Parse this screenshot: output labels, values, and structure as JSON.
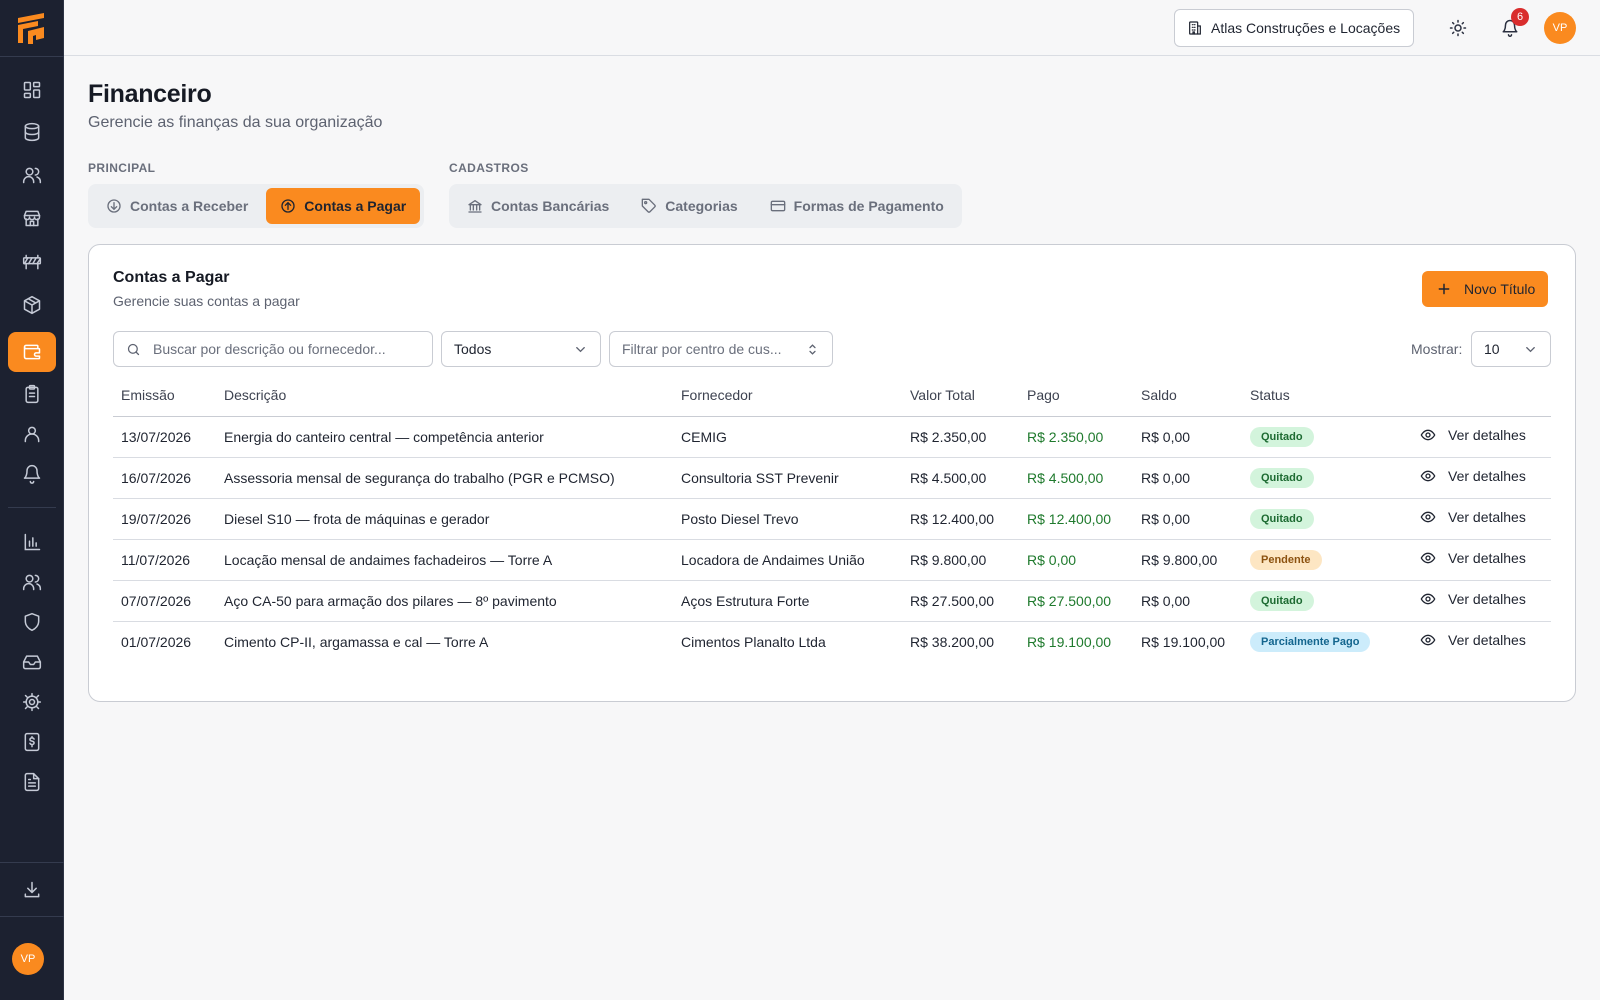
{
  "header": {
    "organization": "Atlas Construções e Locações",
    "notification_count": "6",
    "user_initials": "VP"
  },
  "sidebar": {
    "user_initials": "VP",
    "active_item": "financeiro",
    "items": [
      {
        "icon": "dashboard-icon"
      },
      {
        "icon": "database-icon"
      },
      {
        "icon": "users-icon"
      },
      {
        "icon": "store-icon"
      },
      {
        "icon": "construction-barrier-icon"
      },
      {
        "icon": "package-icon"
      },
      {
        "icon": "wallet-icon"
      },
      {
        "icon": "clipboard-icon"
      },
      {
        "icon": "user-icon"
      },
      {
        "icon": "bell-icon"
      },
      {
        "icon": "bar-chart-icon"
      },
      {
        "icon": "users-icon"
      },
      {
        "icon": "shield-icon"
      },
      {
        "icon": "inbox-icon"
      },
      {
        "icon": "settings-icon"
      },
      {
        "icon": "receipt-icon"
      },
      {
        "icon": "file-text-icon"
      },
      {
        "icon": "download-icon"
      }
    ]
  },
  "page": {
    "title": "Financeiro",
    "subtitle": "Gerencie as finanças da sua organização"
  },
  "tabs": {
    "principal_label": "PRINCIPAL",
    "cadastros_label": "CADASTROS",
    "receber": "Contas a Receber",
    "pagar": "Contas a Pagar",
    "bancarias": "Contas Bancárias",
    "categorias": "Categorias",
    "formas": "Formas de Pagamento",
    "active": "Contas a Pagar"
  },
  "card": {
    "title": "Contas a Pagar",
    "subtitle": "Gerencie suas contas a pagar",
    "new_button": "Novo Título"
  },
  "filters": {
    "search_placeholder": "Buscar por descrição ou fornecedor...",
    "status_value": "Todos",
    "center_placeholder": "Filtrar por centro de cus...",
    "show_label": "Mostrar:",
    "show_value": "10"
  },
  "table": {
    "headers": [
      "Emissão",
      "Descrição",
      "Fornecedor",
      "Valor Total",
      "Pago",
      "Saldo",
      "Status"
    ],
    "details_label": "Ver detalhes",
    "rows": [
      {
        "emissao": "13/07/2026",
        "descricao": "Energia do canteiro central — competência anterior",
        "fornecedor": "CEMIG",
        "total": "R$ 2.350,00",
        "pago": "R$ 2.350,00",
        "saldo": "R$ 0,00",
        "status": "Quitado",
        "status_color": "#d3f4dc"
      },
      {
        "emissao": "16/07/2026",
        "descricao": "Assessoria mensal de segurança do trabalho (PGR e PCMSO)",
        "fornecedor": "Consultoria SST Prevenir",
        "total": "R$ 4.500,00",
        "pago": "R$ 4.500,00",
        "saldo": "R$ 0,00",
        "status": "Quitado",
        "status_color": "#d3f4dc"
      },
      {
        "emissao": "19/07/2026",
        "descricao": "Diesel S10 — frota de máquinas e gerador",
        "fornecedor": "Posto Diesel Trevo",
        "total": "R$ 12.400,00",
        "pago": "R$ 12.400,00",
        "saldo": "R$ 0,00",
        "status": "Quitado",
        "status_color": "#d3f4dc"
      },
      {
        "emissao": "11/07/2026",
        "descricao": "Locação mensal de andaimes fachadeiros — Torre A",
        "fornecedor": "Locadora de Andaimes União",
        "total": "R$ 9.800,00",
        "pago": "R$ 0,00",
        "saldo": "R$ 9.800,00",
        "status": "Pendente",
        "status_color": "#fde6c3"
      },
      {
        "emissao": "07/07/2026",
        "descricao": "Aço CA-50 para armação dos pilares — 8º pavimento",
        "fornecedor": "Aços Estrutura Forte",
        "total": "R$ 27.500,00",
        "pago": "R$ 27.500,00",
        "saldo": "R$ 0,00",
        "status": "Quitado",
        "status_color": "#d3f4dc"
      },
      {
        "emissao": "01/07/2026",
        "descricao": "Cimento CP-II, argamassa e cal — Torre A",
        "fornecedor": "Cimentos Planalto Ltda",
        "total": "R$ 38.200,00",
        "pago": "R$ 19.100,00",
        "saldo": "R$ 19.100,00",
        "status": "Parcialmente Pago",
        "status_color": "#ccecfb"
      }
    ]
  },
  "colors": {
    "accent": "#fa8a1f",
    "sidebar_bg": "#1c2130",
    "paid_text": "#1f7a2d",
    "notification_badge": "#d92d2d"
  }
}
